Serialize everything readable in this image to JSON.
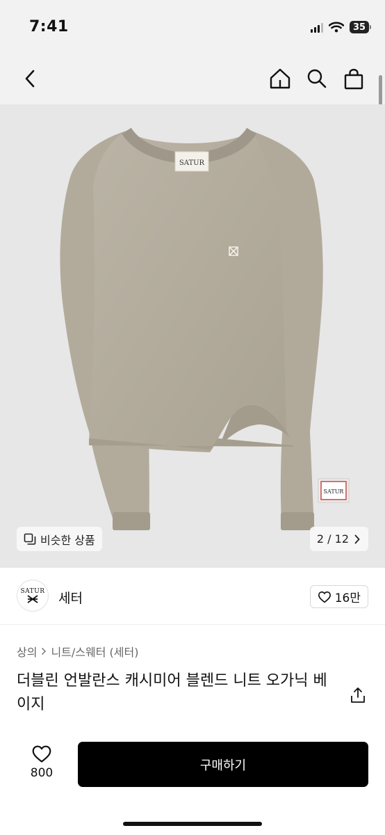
{
  "status": {
    "time": "7:41",
    "battery": "35"
  },
  "nav": {
    "back_icon": "chevron-left-icon",
    "home_icon": "home-icon",
    "search_icon": "search-icon",
    "cart_icon": "shopping-bag-icon"
  },
  "image": {
    "brand_tag": "SATUR",
    "patch_label": "SATUR",
    "similar_label": "비슷한 상품",
    "pager": "2 / 12",
    "colors": {
      "knit": "#b5ae9f",
      "background": "#e7e7e7"
    }
  },
  "seller": {
    "name": "세터",
    "logo_text": "SATUR",
    "likes": "16만"
  },
  "breadcrumb": {
    "level1": "상의",
    "level2": "니트/스웨터 (세터)"
  },
  "product": {
    "title": "더블린 언발란스 캐시미어 블렌드 니트 오가닉 베이지"
  },
  "bottom": {
    "wish_count": "800",
    "buy_label": "구매하기"
  },
  "theme": {
    "accent": "#000000"
  }
}
